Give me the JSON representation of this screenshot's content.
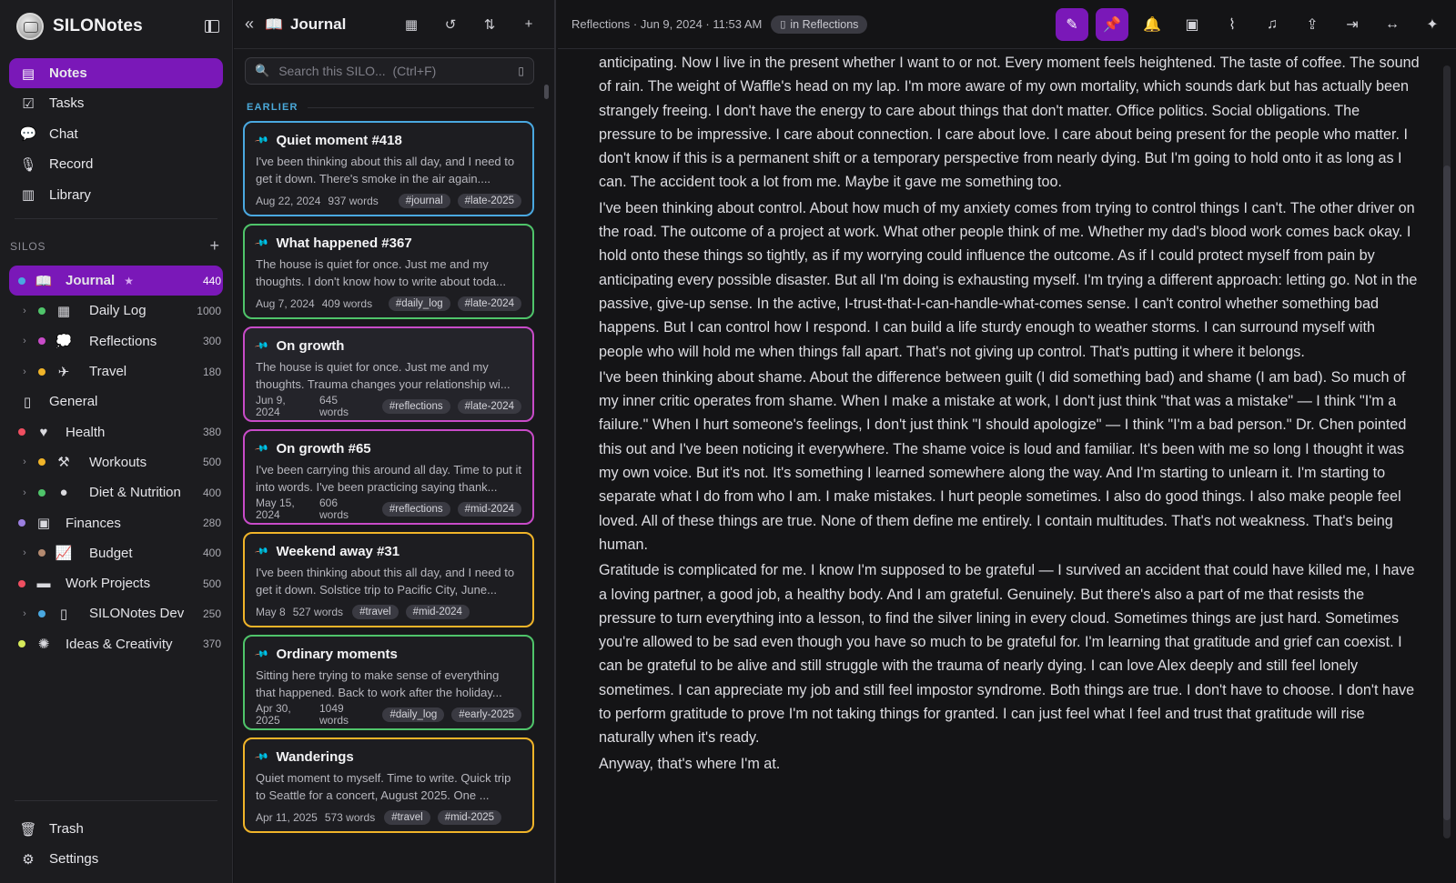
{
  "app": {
    "name": "SILONotes"
  },
  "nav": [
    {
      "label": "Notes",
      "icon": "note-icon",
      "active": true
    },
    {
      "label": "Tasks",
      "icon": "checkbox-icon"
    },
    {
      "label": "Chat",
      "icon": "chat-bubble-icon"
    },
    {
      "label": "Record",
      "icon": "microphone-icon"
    },
    {
      "label": "Library",
      "icon": "library-icon"
    }
  ],
  "silos": {
    "heading": "SILOS",
    "items": [
      {
        "label": "Journal",
        "count": "440",
        "dot": "#4aa8e0",
        "icon": "book-icon",
        "active": true,
        "starred": true,
        "level": 0
      },
      {
        "label": "Daily Log",
        "count": "1000",
        "dot": "#4fc46a",
        "icon": "calendar-icon",
        "level": 1
      },
      {
        "label": "Reflections",
        "count": "300",
        "dot": "#c84bc8",
        "icon": "thought-icon",
        "level": 1
      },
      {
        "label": "Travel",
        "count": "180",
        "dot": "#f0b429",
        "icon": "airplane-icon",
        "level": 1
      },
      {
        "label": "General",
        "count": "",
        "dot": "",
        "icon": "notebook-icon",
        "level": 0
      },
      {
        "label": "Health",
        "count": "380",
        "dot": "#ef4f61",
        "icon": "heartbeat-icon",
        "level": 0
      },
      {
        "label": "Workouts",
        "count": "500",
        "dot": "#f0b429",
        "icon": "dumbbell-icon",
        "level": 1
      },
      {
        "label": "Diet & Nutrition",
        "count": "400",
        "dot": "#4fc46a",
        "icon": "apple-icon",
        "level": 1
      },
      {
        "label": "Finances",
        "count": "280",
        "dot": "#9b7fe0",
        "icon": "money-icon",
        "level": 0
      },
      {
        "label": "Budget",
        "count": "400",
        "dot": "#b48a70",
        "icon": "line-chart-icon",
        "level": 1
      },
      {
        "label": "Work Projects",
        "count": "500",
        "dot": "#ef4f61",
        "icon": "briefcase-icon",
        "level": 0
      },
      {
        "label": "SILONotes Dev",
        "count": "250",
        "dot": "#4aa8e0",
        "icon": "phone-icon",
        "level": 1
      },
      {
        "label": "Ideas & Creativity",
        "count": "370",
        "dot": "#d6ea5a",
        "icon": "lightbulb-icon",
        "level": 0
      }
    ]
  },
  "bottom_nav": [
    {
      "label": "Trash",
      "icon": "trash-icon"
    },
    {
      "label": "Settings",
      "icon": "gear-icon"
    }
  ],
  "list": {
    "title": "Journal",
    "search_placeholder": "Search this SILO...  (Ctrl+F)",
    "section": "EARLIER",
    "cards": [
      {
        "title": "Quiet moment #418",
        "excerpt": "I've been thinking about this all day, and I need to get it down. There's smoke in the air again....",
        "date": "Aug 22, 2024",
        "words": "937 words",
        "tags": [
          "#journal",
          "#late-2025"
        ],
        "border": "#4aa8e0",
        "stack": false
      },
      {
        "title": "What happened #367",
        "excerpt": "The house is quiet for once. Just me and my thoughts. I don't know how to write about toda...",
        "date": "Aug 7, 2024",
        "words": "409 words",
        "tags": [
          "#daily_log",
          "#late-2024"
        ],
        "border": "#4fc46a",
        "stack": false
      },
      {
        "title": "On growth",
        "excerpt": "The house is quiet for once. Just me and my thoughts. Trauma changes your relationship wi...",
        "date": "Jun 9, 2024",
        "words": "645 words",
        "tags": [
          "#reflections",
          "#late-2024"
        ],
        "border": "#c84bc8",
        "stack": true,
        "selected": true
      },
      {
        "title": "On growth #65",
        "excerpt": "I've been carrying this around all day. Time to put it into words. I've been practicing saying thank...",
        "date": "May 15, 2024",
        "words": "606 words",
        "tags": [
          "#reflections",
          "#mid-2024"
        ],
        "border": "#c84bc8",
        "stack": true
      },
      {
        "title": "Weekend away #31",
        "excerpt": "I've been thinking about this all day, and I need to get it down. Solstice trip to Pacific City, June...",
        "date": "May 8",
        "words": "527 words",
        "tags": [
          "#travel",
          "#mid-2024"
        ],
        "border": "#f0b429",
        "stack": false,
        "inline": true
      },
      {
        "title": "Ordinary moments",
        "excerpt": "Sitting here trying to make sense of everything that happened. Back to work after the holiday...",
        "date": "Apr 30, 2025",
        "words": "1049 words",
        "tags": [
          "#daily_log",
          "#early-2025"
        ],
        "border": "#4fc46a",
        "stack": true
      },
      {
        "title": "Wanderings",
        "excerpt": "Quiet moment to myself. Time to write. Quick trip to Seattle for a concert, August 2025. One ...",
        "date": "Apr 11, 2025",
        "words": "573 words",
        "tags": [
          "#travel",
          "#mid-2025"
        ],
        "border": "#f0b429",
        "stack": false,
        "inline": true
      }
    ]
  },
  "editor": {
    "breadcrumb": "Reflections · Jun 9, 2024 · 11:53 AM",
    "badge": "in Reflections",
    "actions": [
      {
        "name": "edit-button",
        "icon": "pencil-icon",
        "glyph": "✎",
        "on": true
      },
      {
        "name": "pin-button",
        "icon": "pin-icon",
        "glyph": "📌",
        "on": true
      },
      {
        "name": "reminder-button",
        "icon": "bell-icon",
        "glyph": "🔔"
      },
      {
        "name": "add-image-button",
        "icon": "image-add-icon",
        "glyph": "▣"
      },
      {
        "name": "attach-button",
        "icon": "paperclip-icon",
        "glyph": "⌇"
      },
      {
        "name": "audio-button",
        "icon": "headphones-icon",
        "glyph": "♫"
      },
      {
        "name": "share-button",
        "icon": "share-icon",
        "glyph": "⇪"
      },
      {
        "name": "move-button",
        "icon": "folder-move-icon",
        "glyph": "⇥"
      },
      {
        "name": "width-button",
        "icon": "expand-width-icon",
        "glyph": "↔"
      },
      {
        "name": "ai-button",
        "icon": "sparkle-icon",
        "glyph": "✦"
      }
    ],
    "paragraphs": [
      "anticipating. Now I live in the present whether I want to or not. Every moment feels heightened. The taste of coffee. The sound of rain. The weight of Waffle's head on my lap. I'm more aware of my own mortality, which sounds dark but has actually been strangely freeing. I don't have the energy to care about things that don't matter. Office politics. Social obligations. The pressure to be impressive. I care about connection. I care about love. I care about being present for the people who matter. I don't know if this is a permanent shift or a temporary perspective from nearly dying. But I'm going to hold onto it as long as I can. The accident took a lot from me. Maybe it gave me something too.",
      "I've been thinking about control. About how much of my anxiety comes from trying to control things I can't. The other driver on the road. The outcome of a project at work. What other people think of me. Whether my dad's blood work comes back okay. I hold onto these things so tightly, as if my worrying could influence the outcome. As if I could protect myself from pain by anticipating every possible disaster. But all I'm doing is exhausting myself. I'm trying a different approach: letting go. Not in the passive, give-up sense. In the active, I-trust-that-I-can-handle-what-comes sense. I can't control whether something bad happens. But I can control how I respond. I can build a life sturdy enough to weather storms. I can surround myself with people who will hold me when things fall apart. That's not giving up control. That's putting it where it belongs.",
      "I've been thinking about shame. About the difference between guilt (I did something bad) and shame (I am bad). So much of my inner critic operates from shame. When I make a mistake at work, I don't just think \"that was a mistake\" — I think \"I'm a failure.\" When I hurt someone's feelings, I don't just think \"I should apologize\" — I think \"I'm a bad person.\" Dr. Chen pointed this out and I've been noticing it everywhere. The shame voice is loud and familiar. It's been with me so long I thought it was my own voice. But it's not. It's something I learned somewhere along the way. And I'm starting to unlearn it. I'm starting to separate what I do from who I am. I make mistakes. I hurt people sometimes. I also do good things. I also make people feel loved. All of these things are true. None of them define me entirely. I contain multitudes. That's not weakness. That's being human.",
      "Gratitude is complicated for me. I know I'm supposed to be grateful — I survived an accident that could have killed me, I have a loving partner, a good job, a healthy body. And I am grateful. Genuinely. But there's also a part of me that resists the pressure to turn everything into a lesson, to find the silver lining in every cloud. Sometimes things are just hard. Sometimes you're allowed to be sad even though you have so much to be grateful for. I'm learning that gratitude and grief can coexist. I can be grateful to be alive and still struggle with the trauma of nearly dying. I can love Alex deeply and still feel lonely sometimes. I can appreciate my job and still feel impostor syndrome. Both things are true. I don't have to choose. I don't have to perform gratitude to prove I'm not taking things for granted. I can just feel what I feel and trust that gratitude will rise naturally when it's ready.",
      "Anyway, that's where I'm at."
    ]
  }
}
